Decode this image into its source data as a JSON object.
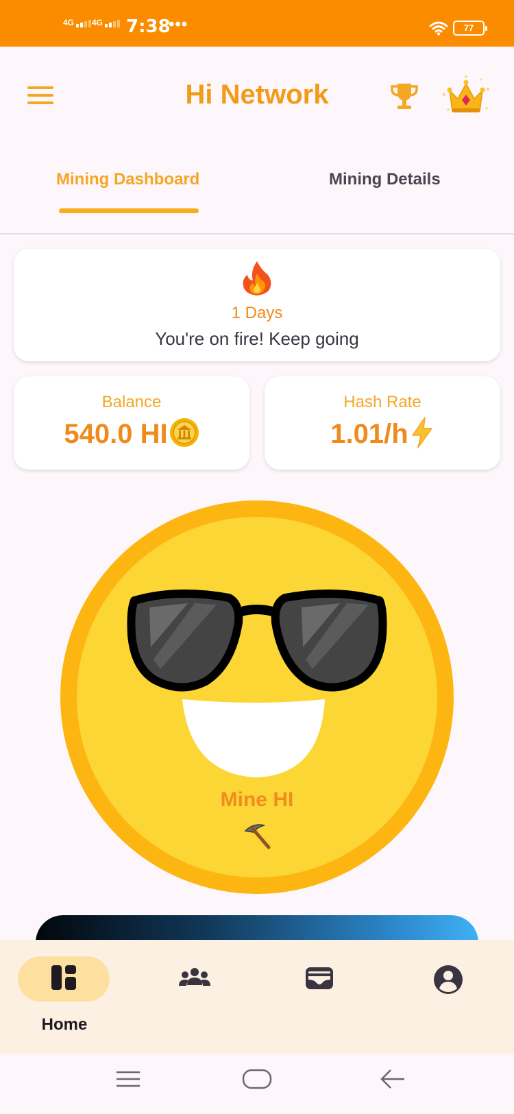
{
  "status_bar": {
    "network_1": "4G",
    "network_2": "4G",
    "time": "7:38",
    "more": "•••",
    "battery": "77"
  },
  "header": {
    "title": "Hi Network",
    "icons": [
      "menu-icon",
      "trophy-icon",
      "crown-icon"
    ]
  },
  "tabs": [
    {
      "label": "Mining Dashboard",
      "active": true
    },
    {
      "label": "Mining Details",
      "active": false
    }
  ],
  "streak": {
    "icon": "fire-icon",
    "days": "1 Days",
    "message": "You're on fire! Keep going"
  },
  "balance": {
    "label": "Balance",
    "value": "540.0 HI",
    "icon": "coin-icon"
  },
  "hash_rate": {
    "label": "Hash Rate",
    "value": "1.01/h",
    "icon": "lightning-icon"
  },
  "mine_button": {
    "label": "Mine HI",
    "icon": "pickaxe-icon"
  },
  "bottom_nav": {
    "items": [
      {
        "label": "Home",
        "icon": "dashboard-icon",
        "active": true
      },
      {
        "label": "",
        "icon": "community-icon",
        "active": false
      },
      {
        "label": "",
        "icon": "wallet-icon",
        "active": false
      },
      {
        "label": "",
        "icon": "profile-icon",
        "active": false
      }
    ]
  },
  "colors": {
    "status_bar": "#fb8c00",
    "accent": "#f5a623",
    "coin_outer": "#fdb511",
    "coin_inner": "#fcd634",
    "nav_bg": "#fcf0e3"
  }
}
